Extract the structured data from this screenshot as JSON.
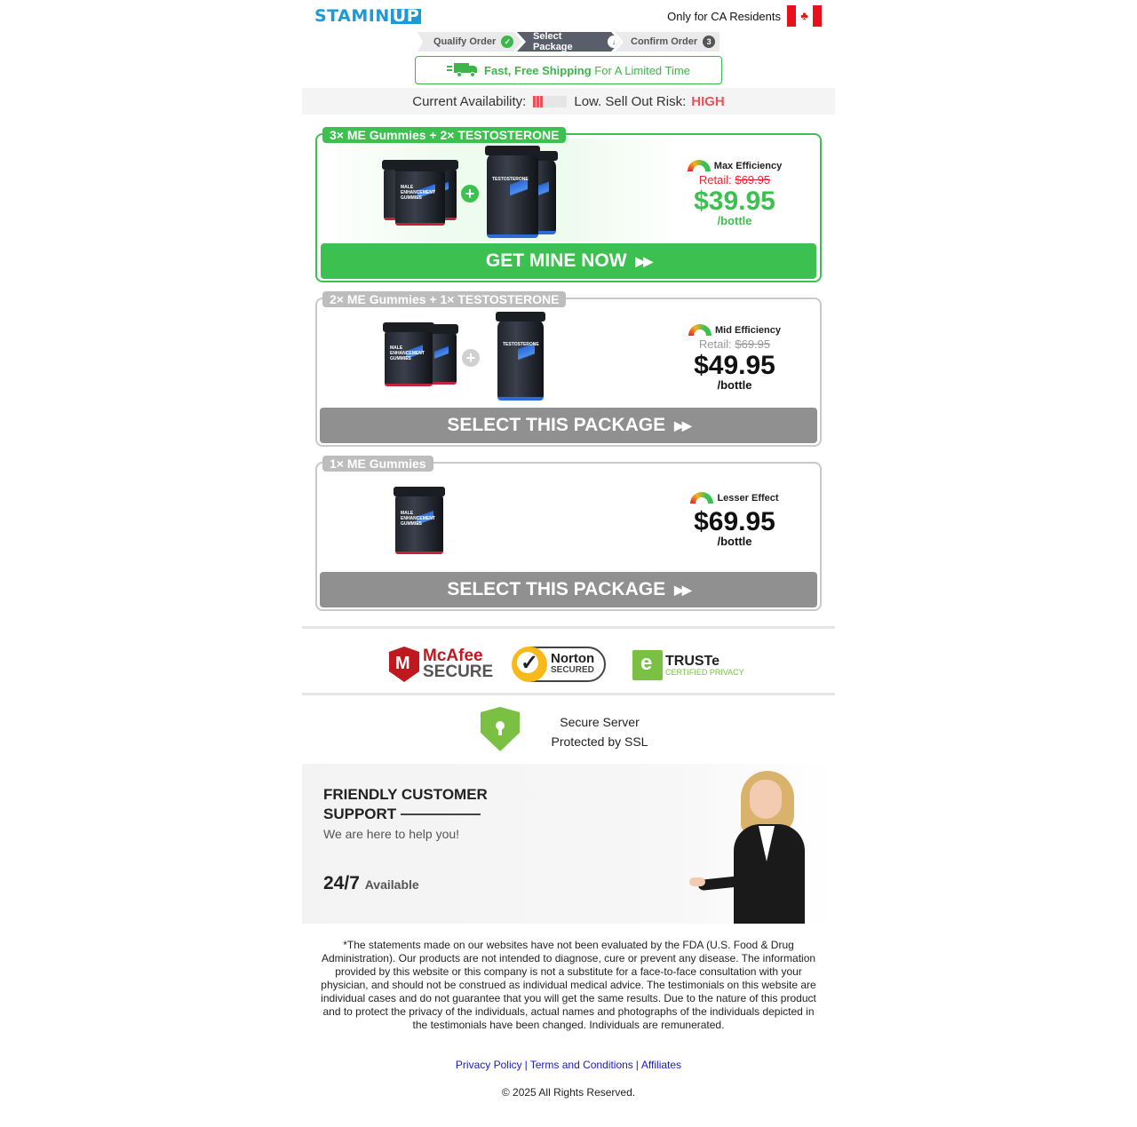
{
  "header": {
    "logo_main": "STAMIN",
    "logo_highlight": "UP",
    "residents_text": "Only for CA Residents"
  },
  "steps": [
    {
      "label": "Qualify Order",
      "marker": "✓"
    },
    {
      "label": "Select Package",
      "marker": "↓"
    },
    {
      "label": "Confirm Order",
      "marker": "3"
    }
  ],
  "shipping": {
    "bold": "Fast, Free Shipping",
    "rest": "For A Limited Time"
  },
  "availability": {
    "label": "Current Availability:",
    "level_fraction": 0.25,
    "sellout_label": "Low. Sell Out Risk:",
    "risk": "HIGH",
    "risk_color": "#e8525a"
  },
  "packages": [
    {
      "label": "3× ME Gummies + 2× TESTOSTERONE",
      "efficiency": "Max Efficiency",
      "retail_label": "Retail:",
      "retail_price": "$69.95",
      "price": "$39.95",
      "per": "/bottle",
      "button": "GET MINE NOW"
    },
    {
      "label": "2× ME Gummies + 1× TESTOSTERONE",
      "efficiency": "Mid Efficiency",
      "retail_label": "Retail:",
      "retail_price": "$69.95",
      "price": "$49.95",
      "per": "/bottle",
      "button": "SELECT THIS PACKAGE"
    },
    {
      "label": "1× ME Gummies",
      "efficiency": "Lesser Effect",
      "price": "$69.95",
      "per": "/bottle",
      "button": "SELECT THIS PACKAGE"
    }
  ],
  "product_labels": {
    "gummies": "MALE ENHANCEMENT GUMMIES",
    "testosterone": "TESTOSTERONE"
  },
  "trust": {
    "mcafee_1": "McAfee",
    "mcafee_2": "SECURE",
    "norton_1": "Norton",
    "norton_2": "SECURED",
    "truste_1": "TRUSTe",
    "truste_2": "CERTIFIED PRIVACY"
  },
  "ssl": {
    "line1": "Secure Server",
    "line2": "Protected by SSL"
  },
  "support": {
    "title_1": "FRIENDLY CUSTOMER",
    "title_2": "SUPPORT",
    "help": "We are here to help you!",
    "hours": "24/7",
    "available": "Available"
  },
  "disclaimer": "*The statements made on our websites have not been evaluated by the FDA (U.S. Food & Drug Administration). Our products are not intended to diagnose, cure or prevent any disease. The information provided by this website or this company is not a substitute for a face-to-face consultation with your physician, and should not be construed as individual medical advice. The testimonials on this website are individual cases and do not guarantee that you will get the same results. Due to the nature of this product and to protect the privacy of the individuals, actual names and photographs of the individuals depicted in the testimonials have been changed. Individuals are remunerated.",
  "footer": {
    "links": [
      "Privacy Policy",
      "Terms and Conditions",
      "Affiliates"
    ],
    "separator": "|",
    "copyright": "© 2025 All Rights Reserved."
  },
  "colors": {
    "brand": "#1b9ad6",
    "accent_green": "#3cc150",
    "inactive_grey": "#909090",
    "alert_red": "#e8252f"
  }
}
